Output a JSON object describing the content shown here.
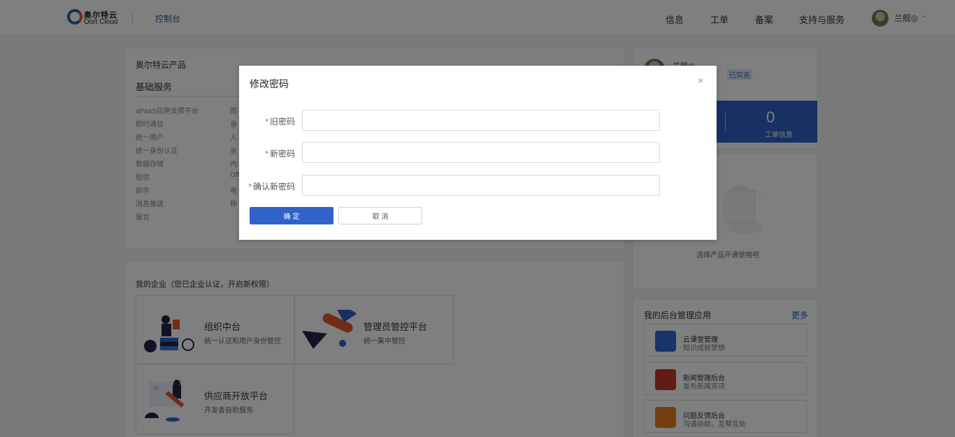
{
  "header": {
    "logo_cn": "奥尔特云",
    "logo_en": "Oort Cloud",
    "console": "控制台",
    "nav": [
      "信息",
      "工单",
      "备案",
      "支持与服务"
    ],
    "username": "兰舰◎"
  },
  "products": {
    "title": "奥尔特云产品",
    "basic_title": "基础服务",
    "services_col1": [
      "aPaaS应用支撑平台",
      "即时通信",
      "统一用户",
      "统一身份认证",
      "数据存储",
      "短信",
      "邮件",
      "消息推送",
      "留言"
    ],
    "services_col2": [
      "图",
      "身",
      "人",
      "坐",
      "内",
      "Off",
      "电",
      "移"
    ]
  },
  "enterprise": {
    "title": "我的企业（您已企业认证，开启新权限）",
    "tiles": [
      {
        "title": "组织中台",
        "sub": "统一认证和用户身份管控"
      },
      {
        "title": "管理员管控平台",
        "sub": "统一集中管控"
      },
      {
        "title": "供应商开放平台",
        "sub": "开发者自助服务"
      }
    ]
  },
  "profile": {
    "name": "兰舰◎",
    "badge": "已实名",
    "stat_value": "0",
    "stat_label": "工单信息",
    "empty_text": "选择产品开通使用吧"
  },
  "apps": {
    "title": "我的后台管理应用",
    "more": "更多",
    "items": [
      {
        "name": "云课堂管理",
        "desc": "知识成就梦想",
        "color": "#2f6bd4"
      },
      {
        "name": "新闻管理后台",
        "desc": "发布新闻资讯",
        "color": "#c0392b"
      },
      {
        "name": "问题反馈后台",
        "desc": "沟通协助，互帮互助",
        "color": "#e67e22"
      }
    ]
  },
  "modal": {
    "title": "修改密码",
    "close": "×",
    "req": "*",
    "fields": [
      {
        "label": "旧密码",
        "value": ""
      },
      {
        "label": "新密码",
        "value": ""
      },
      {
        "label": "确认新密码",
        "value": ""
      }
    ],
    "ok": "确 定",
    "cancel": "取 消"
  }
}
